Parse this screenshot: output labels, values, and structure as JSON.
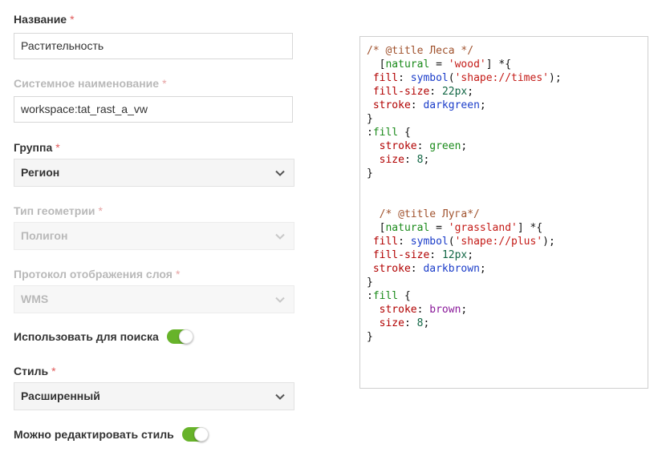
{
  "form": {
    "name": {
      "label": "Название",
      "required": "*",
      "value": "Растительность"
    },
    "system_name": {
      "label": "Системное наименование",
      "required": "*",
      "value": "workspace:tat_rast_a_vw"
    },
    "group": {
      "label": "Группа",
      "required": "*",
      "value": "Регион"
    },
    "geometry_type": {
      "label": "Тип геометрии",
      "required": "*",
      "value": "Полигон"
    },
    "protocol": {
      "label": "Протокол отображения слоя",
      "required": "*",
      "value": "WMS"
    },
    "use_for_search": {
      "label": "Использовать для поиска",
      "state": "on"
    },
    "style": {
      "label": "Стиль",
      "required": "*",
      "value": "Расширенный"
    },
    "style_editable": {
      "label": "Можно редактировать стиль",
      "state": "on"
    }
  },
  "colors": {
    "toggle_on": "#67b32a",
    "required_mark": "#e05a5a"
  },
  "icons": {
    "select_arrow": "chevron-down-icon"
  },
  "editor": {
    "lines": [
      [
        [
          "c",
          "/* @title Леса */"
        ]
      ],
      [
        [
          "t",
          "  ["
        ],
        [
          "green",
          "natural"
        ],
        [
          "t",
          " = "
        ],
        [
          "s",
          "'wood'"
        ],
        [
          "t",
          "] *{"
        ]
      ],
      [
        [
          "t",
          " "
        ],
        [
          "k",
          "fill"
        ],
        [
          "t",
          ": "
        ],
        [
          "blue",
          "symbol"
        ],
        [
          "t",
          "("
        ],
        [
          "s",
          "'shape://times'"
        ],
        [
          "t",
          ");"
        ]
      ],
      [
        [
          "t",
          " "
        ],
        [
          "k",
          "fill-size"
        ],
        [
          "t",
          ": "
        ],
        [
          "teal",
          "22px"
        ],
        [
          "t",
          ";"
        ]
      ],
      [
        [
          "t",
          " "
        ],
        [
          "k",
          "stroke"
        ],
        [
          "t",
          ": "
        ],
        [
          "blue",
          "darkgreen"
        ],
        [
          "t",
          ";"
        ]
      ],
      [
        [
          "t",
          "}"
        ]
      ],
      [
        [
          "t",
          ":"
        ],
        [
          "green",
          "fill"
        ],
        [
          "t",
          " {"
        ]
      ],
      [
        [
          "t",
          "  "
        ],
        [
          "k",
          "stroke"
        ],
        [
          "t",
          ": "
        ],
        [
          "green",
          "green"
        ],
        [
          "t",
          ";"
        ]
      ],
      [
        [
          "t",
          "  "
        ],
        [
          "k",
          "size"
        ],
        [
          "t",
          ": "
        ],
        [
          "teal",
          "8"
        ],
        [
          "t",
          ";"
        ]
      ],
      [
        [
          "t",
          "}"
        ]
      ],
      [
        [
          "t",
          ""
        ]
      ],
      [
        [
          "t",
          ""
        ]
      ],
      [
        [
          "t",
          "  "
        ],
        [
          "c",
          "/* @title Луга*/"
        ]
      ],
      [
        [
          "t",
          "  ["
        ],
        [
          "green",
          "natural"
        ],
        [
          "t",
          " = "
        ],
        [
          "s",
          "'grassland'"
        ],
        [
          "t",
          "] *{"
        ]
      ],
      [
        [
          "t",
          " "
        ],
        [
          "k",
          "fill"
        ],
        [
          "t",
          ": "
        ],
        [
          "blue",
          "symbol"
        ],
        [
          "t",
          "("
        ],
        [
          "s",
          "'shape://plus'"
        ],
        [
          "t",
          ");"
        ]
      ],
      [
        [
          "t",
          " "
        ],
        [
          "k",
          "fill-size"
        ],
        [
          "t",
          ": "
        ],
        [
          "teal",
          "12px"
        ],
        [
          "t",
          ";"
        ]
      ],
      [
        [
          "t",
          " "
        ],
        [
          "k",
          "stroke"
        ],
        [
          "t",
          ": "
        ],
        [
          "blue",
          "darkbrown"
        ],
        [
          "t",
          ";"
        ]
      ],
      [
        [
          "t",
          "}"
        ]
      ],
      [
        [
          "t",
          ":"
        ],
        [
          "green",
          "fill"
        ],
        [
          "t",
          " {"
        ]
      ],
      [
        [
          "t",
          "  "
        ],
        [
          "k",
          "stroke"
        ],
        [
          "t",
          ": "
        ],
        [
          "purple",
          "brown"
        ],
        [
          "t",
          ";"
        ]
      ],
      [
        [
          "t",
          "  "
        ],
        [
          "k",
          "size"
        ],
        [
          "t",
          ": "
        ],
        [
          "teal",
          "8"
        ],
        [
          "t",
          ";"
        ]
      ],
      [
        [
          "t",
          "}"
        ]
      ]
    ]
  }
}
